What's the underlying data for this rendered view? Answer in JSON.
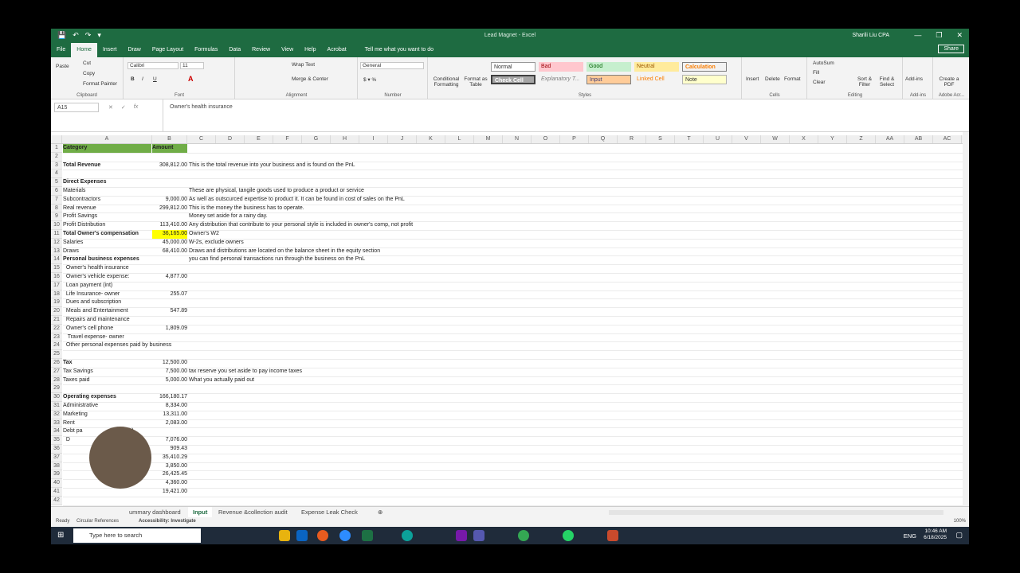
{
  "window": {
    "doc_title": "Lead Magnet - Excel",
    "user": "Sharili Liu CPA"
  },
  "qat": [
    "💾",
    "↶",
    "↷",
    "▾"
  ],
  "menu": {
    "tabs": [
      "File",
      "Home",
      "Insert",
      "Draw",
      "Page Layout",
      "Formulas",
      "Data",
      "Review",
      "View",
      "Help",
      "Acrobat"
    ],
    "tell_me": "Tell me what you want to do",
    "share": "Share"
  },
  "ribbon": {
    "clipboard": {
      "paste": "Paste",
      "cut": "Cut",
      "copy": "Copy",
      "format_painter": "Format Painter",
      "label": "Clipboard"
    },
    "font": {
      "name": "Calibri",
      "size": "11",
      "bold": "B",
      "italic": "I",
      "underline": "U",
      "label": "Font"
    },
    "alignment": {
      "wrap": "Wrap Text",
      "merge": "Merge & Center",
      "label": "Alignment"
    },
    "number": {
      "format": "General",
      "label": "Number"
    },
    "styles": {
      "conditional": "Conditional Formatting",
      "format_table": "Format as Table",
      "cells": [
        "Normal",
        "Bad",
        "Good",
        "Neutral",
        "Calculation",
        "Check Cell",
        "Explanatory T...",
        "Input",
        "Linked Cell",
        "Note"
      ],
      "label": "Styles"
    },
    "cells": {
      "insert": "Insert",
      "delete": "Delete",
      "format": "Format",
      "label": "Cells"
    },
    "editing": {
      "autosum": "AutoSum",
      "fill": "Fill",
      "clear": "Clear",
      "sort": "Sort & Filter",
      "find": "Find & Select",
      "label": "Editing"
    },
    "addins": {
      "addins": "Add-ins",
      "label": "Add-ins"
    },
    "adobe": {
      "create": "Create a PDF",
      "label": "Adobe Acr..."
    }
  },
  "formula_bar": {
    "cell": "A15",
    "content": "Owner's health insurance"
  },
  "columns": [
    "A",
    "B",
    "C",
    "D",
    "E",
    "F",
    "G",
    "H",
    "I",
    "J",
    "K",
    "L",
    "M",
    "N",
    "O",
    "P",
    "Q",
    "R",
    "S",
    "T",
    "U",
    "V",
    "W",
    "X",
    "Y",
    "Z",
    "AA",
    "AB",
    "AC"
  ],
  "rows": [
    {
      "n": "1",
      "a": "Category",
      "b": "Amount",
      "c": "",
      "style": "hdr"
    },
    {
      "n": "2",
      "a": "",
      "b": "",
      "c": ""
    },
    {
      "n": "3",
      "a": "Total Revenue",
      "b": "308,812.00",
      "c": "This is the total revenue into your business and is found on the PnL",
      "style": "bold"
    },
    {
      "n": "4",
      "a": "",
      "b": "",
      "c": ""
    },
    {
      "n": "5",
      "a": "Direct Expenses",
      "b": "",
      "c": "",
      "style": "bold"
    },
    {
      "n": "6",
      "a": "Materials",
      "b": "",
      "c": "These are physical, tangile goods used to produce a product or service"
    },
    {
      "n": "7",
      "a": "Subcontractors",
      "b": "9,000.00",
      "c": "As well as outscurced expertise to product it. It can be found in cost of sales on the PnL",
      "style": "ul"
    },
    {
      "n": "8",
      "a": "Real revenue",
      "b": "299,812.00",
      "c": "This is the money the business has to operate."
    },
    {
      "n": "9",
      "a": "Profit Savings",
      "b": "",
      "c": "Money set aside for a rainy day."
    },
    {
      "n": "10",
      "a": "Profit Distribution",
      "b": "113,410.00",
      "c": "Any distribution that contribute to your personal style is included in owner's comp, not profit"
    },
    {
      "n": "11",
      "a": "Total Owner's compensation",
      "b": "36,165.00",
      "c": "Owner's W2",
      "style": "boldhi"
    },
    {
      "n": "12",
      "a": "Salaries",
      "b": "45,000.00",
      "c": "W-2s, exclude owners"
    },
    {
      "n": "13",
      "a": "Draws",
      "b": "68,410.00",
      "c": "Draws and distributions are located on the balance sheet in the equity section"
    },
    {
      "n": "14",
      "a": "Personal business expenses",
      "b": "",
      "c": "you can find personal transactions run through the business on the PnL",
      "style": "bold"
    },
    {
      "n": "15",
      "a": "  Owner's health insurance",
      "b": "",
      "c": ""
    },
    {
      "n": "16",
      "a": "  Owner's vehicle expense:",
      "b": "4,877.00",
      "c": ""
    },
    {
      "n": "17",
      "a": "  Loan payment (int)",
      "b": "",
      "c": ""
    },
    {
      "n": "18",
      "a": "  Life Insurance- owner",
      "b": "255.07",
      "c": ""
    },
    {
      "n": "19",
      "a": "  Dues and subscription",
      "b": "",
      "c": ""
    },
    {
      "n": "20",
      "a": "  Meals and Entertainment",
      "b": "547.89",
      "c": ""
    },
    {
      "n": "21",
      "a": "  Repairs and maintenance",
      "b": "",
      "c": ""
    },
    {
      "n": "22",
      "a": "  Owner's cell phone",
      "b": "1,809.09",
      "c": ""
    },
    {
      "n": "23",
      "a": "   Travel expense- owner",
      "b": "",
      "c": ""
    },
    {
      "n": "24",
      "a": "  Other personal expenses paid by business",
      "b": "",
      "c": ""
    },
    {
      "n": "25",
      "a": "",
      "b": "",
      "c": ""
    },
    {
      "n": "26",
      "a": "Tax",
      "b": "12,500.00",
      "c": "",
      "style": "bold"
    },
    {
      "n": "27",
      "a": "Tax Savings",
      "b": "7,500.00",
      "c": "tax reserve you set aside to pay income taxes"
    },
    {
      "n": "28",
      "a": "Taxes paid",
      "b": "5,000.00",
      "c": "What you actually paid out"
    },
    {
      "n": "29",
      "a": "",
      "b": "",
      "c": ""
    },
    {
      "n": "30",
      "a": "Operating expenses",
      "b": "166,180.17",
      "c": "",
      "style": "bold"
    },
    {
      "n": "31",
      "a": "Administrative",
      "b": "8,334.00",
      "c": ""
    },
    {
      "n": "32",
      "a": "Marketing",
      "b": "13,311.00",
      "c": ""
    },
    {
      "n": "33",
      "a": "Rent",
      "b": "2,083.00",
      "c": ""
    },
    {
      "n": "34",
      "a": "Debt pa                  payment)",
      "b": "",
      "c": ""
    },
    {
      "n": "35",
      "a": "  D",
      "b": "7,076.00",
      "c": ""
    },
    {
      "n": "36",
      "a": "",
      "b": "909.43",
      "c": ""
    },
    {
      "n": "37",
      "a": "",
      "b": "35,410.29",
      "c": ""
    },
    {
      "n": "38",
      "a": "",
      "b": "3,850.00",
      "c": ""
    },
    {
      "n": "39",
      "a": "",
      "b": "26,425.45",
      "c": ""
    },
    {
      "n": "40",
      "a": "",
      "b": "4,360.00",
      "c": ""
    },
    {
      "n": "41",
      "a": "",
      "b": "19,421.00",
      "c": ""
    },
    {
      "n": "42",
      "a": "",
      "b": "",
      "c": ""
    }
  ],
  "sheets": [
    "ummary dashboard",
    "Input",
    "Revenue &collection audit",
    "Expense Leak Check"
  ],
  "status": {
    "ready": "Ready",
    "circular": "Circular References",
    "accessibility": "Accessibility: Investigate",
    "zoom": "100%"
  },
  "taskbar": {
    "search": "Type here to search",
    "lang": "ENG",
    "time": "10:46 AM",
    "date": "6/18/2025"
  }
}
